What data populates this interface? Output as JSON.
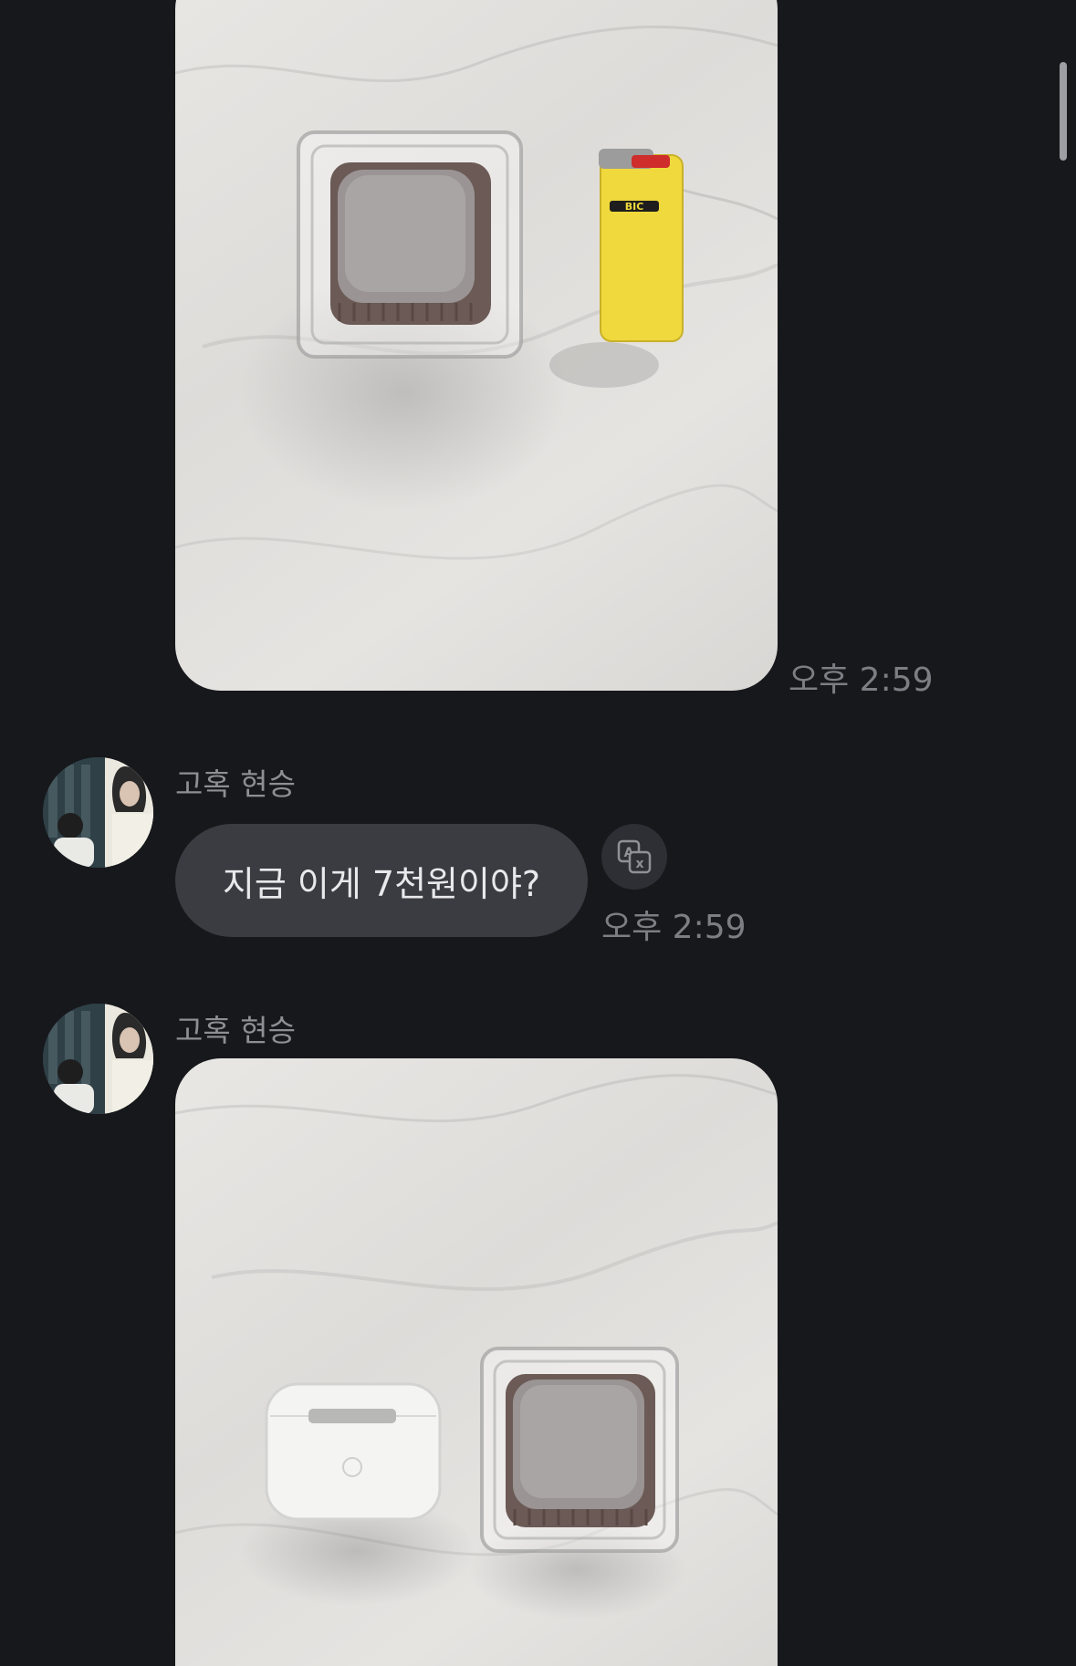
{
  "messages": [
    {
      "type": "image",
      "time": "오후 2:59",
      "image_alt": "Plastic-packaged brownie beside a yellow lighter on marble"
    },
    {
      "type": "text",
      "sender": "고혹 현승",
      "text": "지금 이게 7천원이야?",
      "time": "오후 2:59"
    },
    {
      "type": "image",
      "sender": "고혹 현승",
      "image_alt": "AirPods case beside a plastic-packaged brownie on marble"
    }
  ],
  "lighter_brand": "BIC",
  "colors": {
    "background": "#17181c",
    "bubble": "#3a3c42",
    "timestamp": "#7c7e84",
    "sender_name": "#8d8f95"
  }
}
